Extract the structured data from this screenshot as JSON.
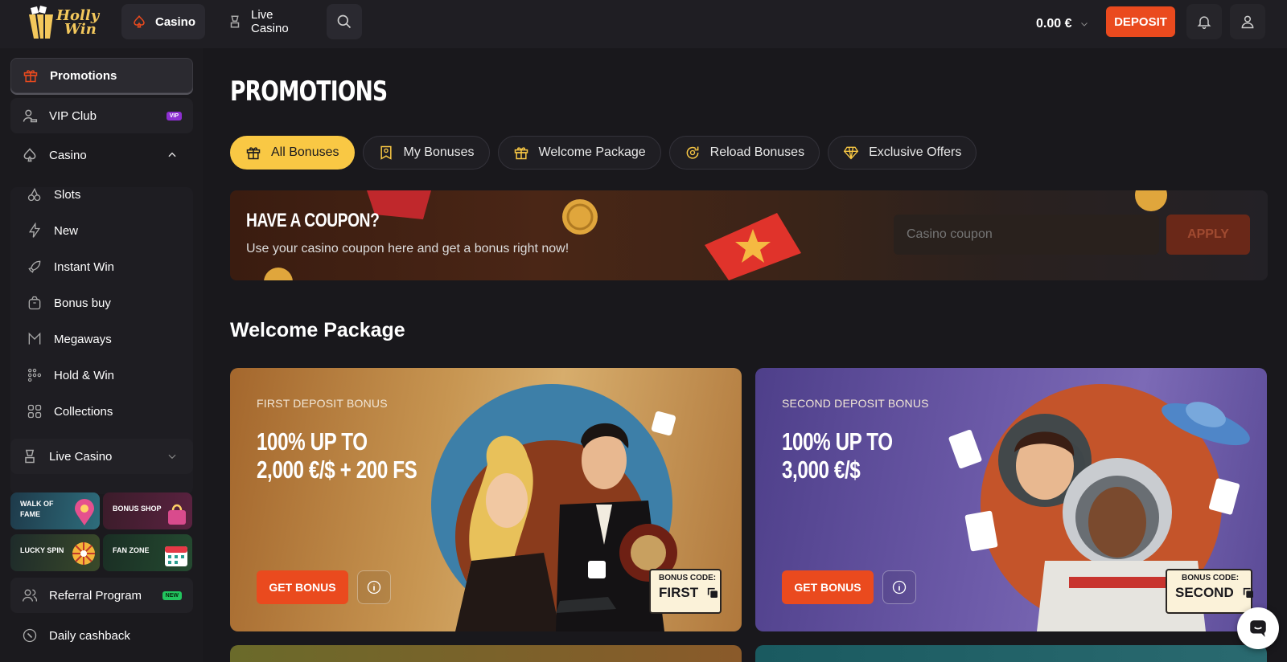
{
  "brand": {
    "name_line1": "Holly",
    "name_line2": "Win"
  },
  "header": {
    "nav_casino": "Casino",
    "nav_live_casino": "Live Casino",
    "balance": "0.00 €",
    "deposit_label": "DEPOSIT"
  },
  "sidebar": {
    "promotions": "Promotions",
    "vip_club": "VIP Club",
    "vip_badge": "VIP",
    "casino": "Casino",
    "casino_items": [
      "Slots",
      "New",
      "Instant Win",
      "Bonus buy",
      "Megaways",
      "Hold & Win",
      "Collections"
    ],
    "live_casino": "Live Casino",
    "tiles": [
      {
        "label_line1": "WALK OF",
        "label_line2": "FAME"
      },
      {
        "label_line1": "BONUS SHOP",
        "label_line2": ""
      },
      {
        "label_line1": "LUCKY SPIN",
        "label_line2": ""
      },
      {
        "label_line1": "FAN ZONE",
        "label_line2": ""
      }
    ],
    "referral": "Referral Program",
    "new_badge": "NEW",
    "daily_cashback": "Daily cashback"
  },
  "main": {
    "title": "PROMOTIONS",
    "tabs": [
      {
        "label": "All Bonuses",
        "icon": "gift-icon",
        "active": true
      },
      {
        "label": "My Bonuses",
        "icon": "bookmark-user-icon",
        "active": false
      },
      {
        "label": "Welcome Package",
        "icon": "gift-box-icon",
        "active": false
      },
      {
        "label": "Reload Bonuses",
        "icon": "reload-icon",
        "active": false
      },
      {
        "label": "Exclusive Offers",
        "icon": "diamond-icon",
        "active": false
      }
    ],
    "coupon": {
      "title": "HAVE A COUPON?",
      "subtitle": "Use your casino coupon here and get a bonus right now!",
      "placeholder": "Casino coupon",
      "apply_label": "APPLY"
    },
    "section_title": "Welcome Package",
    "cards": [
      {
        "label": "FIRST DEPOSIT BONUS",
        "head_line1": "100% UP TO",
        "head_line2": "2,000 €/$ + 200 FS",
        "button": "GET BONUS",
        "code_label": "BONUS CODE:",
        "code": "FIRST"
      },
      {
        "label": "SECOND DEPOSIT BONUS",
        "head_line1": "100% UP TO",
        "head_line2": "3,000 €/$",
        "button": "GET BONUS",
        "code_label": "BONUS CODE:",
        "code": "SECOND"
      }
    ]
  },
  "colors": {
    "accent_orange": "#ea4a1e",
    "accent_yellow": "#f9c844",
    "background": "#19181c"
  }
}
